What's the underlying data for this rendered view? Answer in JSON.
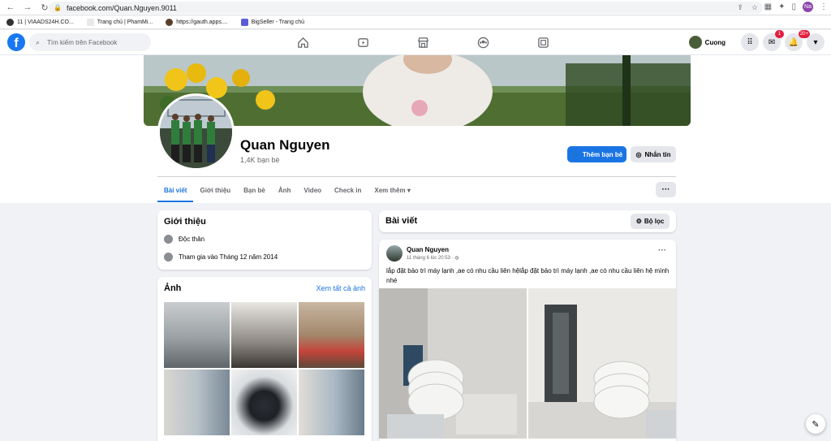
{
  "browser": {
    "url": "facebook.com/Quan.Nguyen.9011",
    "profile_initials": "Na",
    "bookmarks": [
      {
        "label": "11 | VIAADS24H.CO...",
        "color": "#333333"
      },
      {
        "label": "Trang chủ | PhamMi...",
        "color": "#e9e9e9"
      },
      {
        "label": "https://gauth.apps....",
        "color": "#5a3e2b"
      },
      {
        "label": "BigSeller - Trang chủ",
        "color": "#5b5bd6"
      }
    ]
  },
  "header": {
    "logo": "f",
    "search_placeholder": "Tìm kiếm trên Facebook",
    "user_name": "Cuong",
    "messenger_badge": "1",
    "notification_badge": "20+"
  },
  "profile": {
    "name": "Quan Nguyen",
    "friends": "1,4K bạn bè",
    "add_friend": "Thêm bạn bè",
    "message": "Nhắn tin",
    "tabs": [
      "Bài viết",
      "Giới thiệu",
      "Bạn bè",
      "Ảnh",
      "Video",
      "Check in",
      "Xem thêm ▾"
    ],
    "more_dots": "···"
  },
  "intro": {
    "title": "Giới thiệu",
    "relationship": "Độc thân",
    "joined": "Tham gia vào Tháng 12 năm 2014"
  },
  "photos": {
    "title": "Ảnh",
    "see_all": "Xem tất cả ảnh"
  },
  "posts": {
    "title": "Bài viết",
    "filter": "Bộ lọc",
    "post": {
      "author": "Quan Nguyen",
      "time": "11 tháng 6 lúc 20:53 · ",
      "menu": "···",
      "text": "lắp đặt bảo trì máy lạnh ,ae có nhu cầu liên hệlắp đặt bảo trì máy lạnh ,ae có nhu cầu liên hệ mình nhé"
    }
  }
}
